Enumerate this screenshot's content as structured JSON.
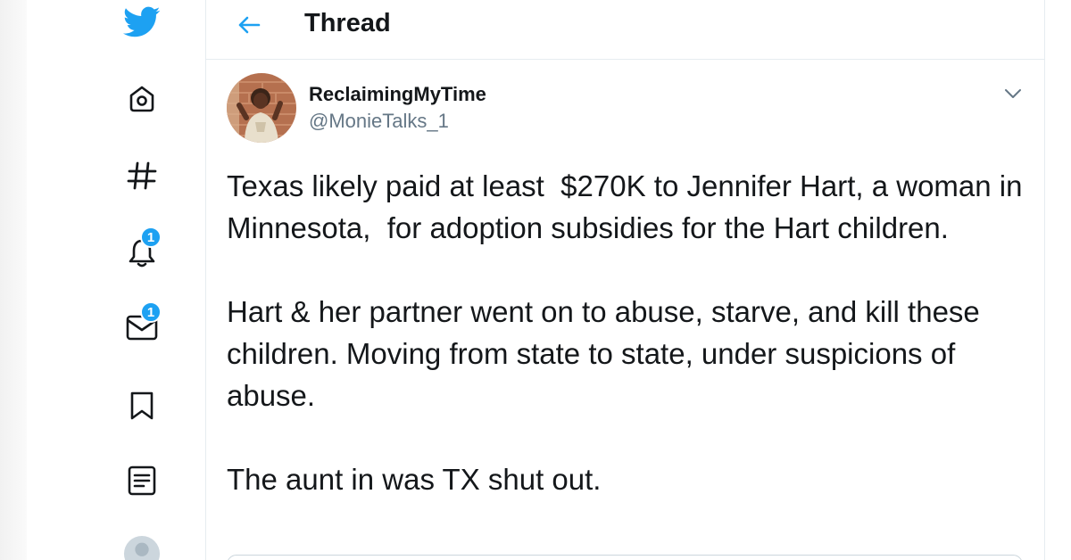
{
  "colors": {
    "brand": "#1da1f2",
    "text_primary": "#14171a",
    "text_secondary": "#657786",
    "border": "#e6ecf0"
  },
  "sidebar": {
    "items": [
      {
        "icon": "twitter-bird-icon"
      },
      {
        "icon": "home-icon"
      },
      {
        "icon": "explore-hashtag-icon"
      },
      {
        "icon": "notifications-bell-icon",
        "badge": "1"
      },
      {
        "icon": "messages-envelope-icon",
        "badge": "1"
      },
      {
        "icon": "bookmark-icon"
      },
      {
        "icon": "lists-icon"
      },
      {
        "icon": "profile-avatar-icon"
      }
    ]
  },
  "header": {
    "back_icon": "back-arrow-icon",
    "title": "Thread"
  },
  "tweet": {
    "display_name": "ReclaimingMyTime",
    "handle": "@MonieTalks_1",
    "menu_icon": "chevron-down-icon",
    "paragraphs": [
      "Texas likely paid at least  $270K to Jennifer Hart, a woman in Minnesota,  for adoption subsidies for the Hart children.",
      "Hart & her partner went on to abuse, starve, and kill these children. Moving from state to state, under suspicions of abuse.",
      "The aunt in was TX shut out."
    ]
  }
}
